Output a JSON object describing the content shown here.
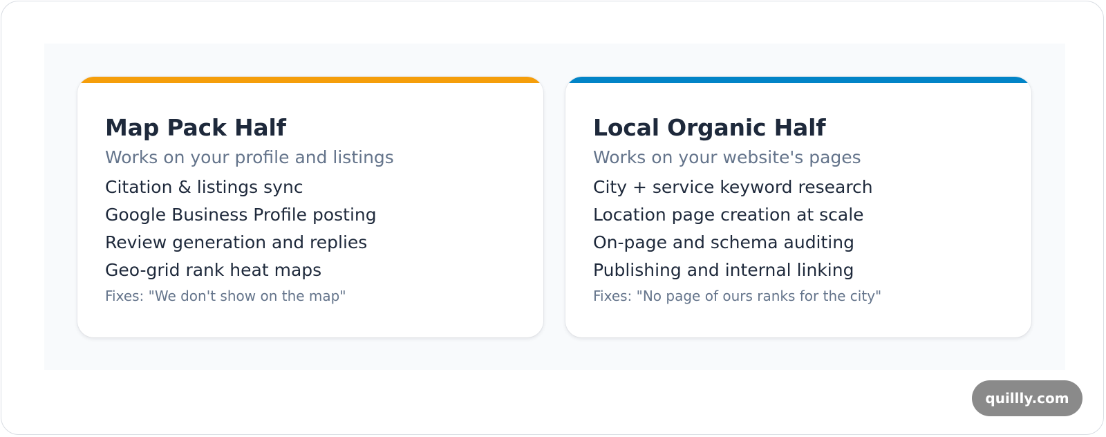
{
  "cards": [
    {
      "title": "Map Pack Half",
      "subtitle": "Works on your profile and listings",
      "items": [
        "Citation & listings sync",
        "Google Business Profile posting",
        "Review generation and replies",
        "Geo-grid rank heat maps"
      ],
      "fix": "Fixes: \"We don't show on the map\"",
      "accent_color": "#f59e0b"
    },
    {
      "title": "Local Organic Half",
      "subtitle": "Works on your website's pages",
      "items": [
        "City + service keyword research",
        "Location page creation at scale",
        "On-page and schema auditing",
        "Publishing and internal linking"
      ],
      "fix": "Fixes: \"No page of ours ranks for the city\"",
      "accent_color": "#0284c7"
    }
  ],
  "watermark": {
    "label": "quillly.com"
  }
}
